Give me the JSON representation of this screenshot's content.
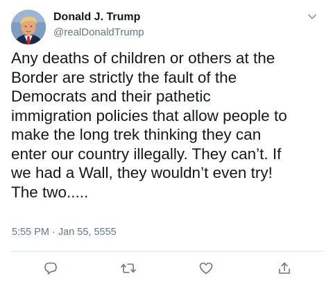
{
  "author": {
    "display_name": "Donald J. Trump",
    "handle": "@realDonaldTrump"
  },
  "tweet": {
    "text": "Any deaths of children or others at the\nBorder are strictly the fault of the\nDemocrats and their pathetic\nimmigration policies that allow people to\nmake the long trek thinking they can\nenter our country illegally. They can’t. If\nwe had a Wall, they wouldn’t even try!\nThe two.....",
    "timestamp": "5:55 PM · Jan 55, 5555"
  },
  "icons": {
    "menu": "chevron-down-icon",
    "reply": "reply-icon",
    "retweet": "retweet-icon",
    "like": "heart-icon",
    "share": "share-icon"
  },
  "colors": {
    "text": "#14171a",
    "secondary": "#657786",
    "icon": "#657786",
    "divider": "#e1e8ed"
  }
}
